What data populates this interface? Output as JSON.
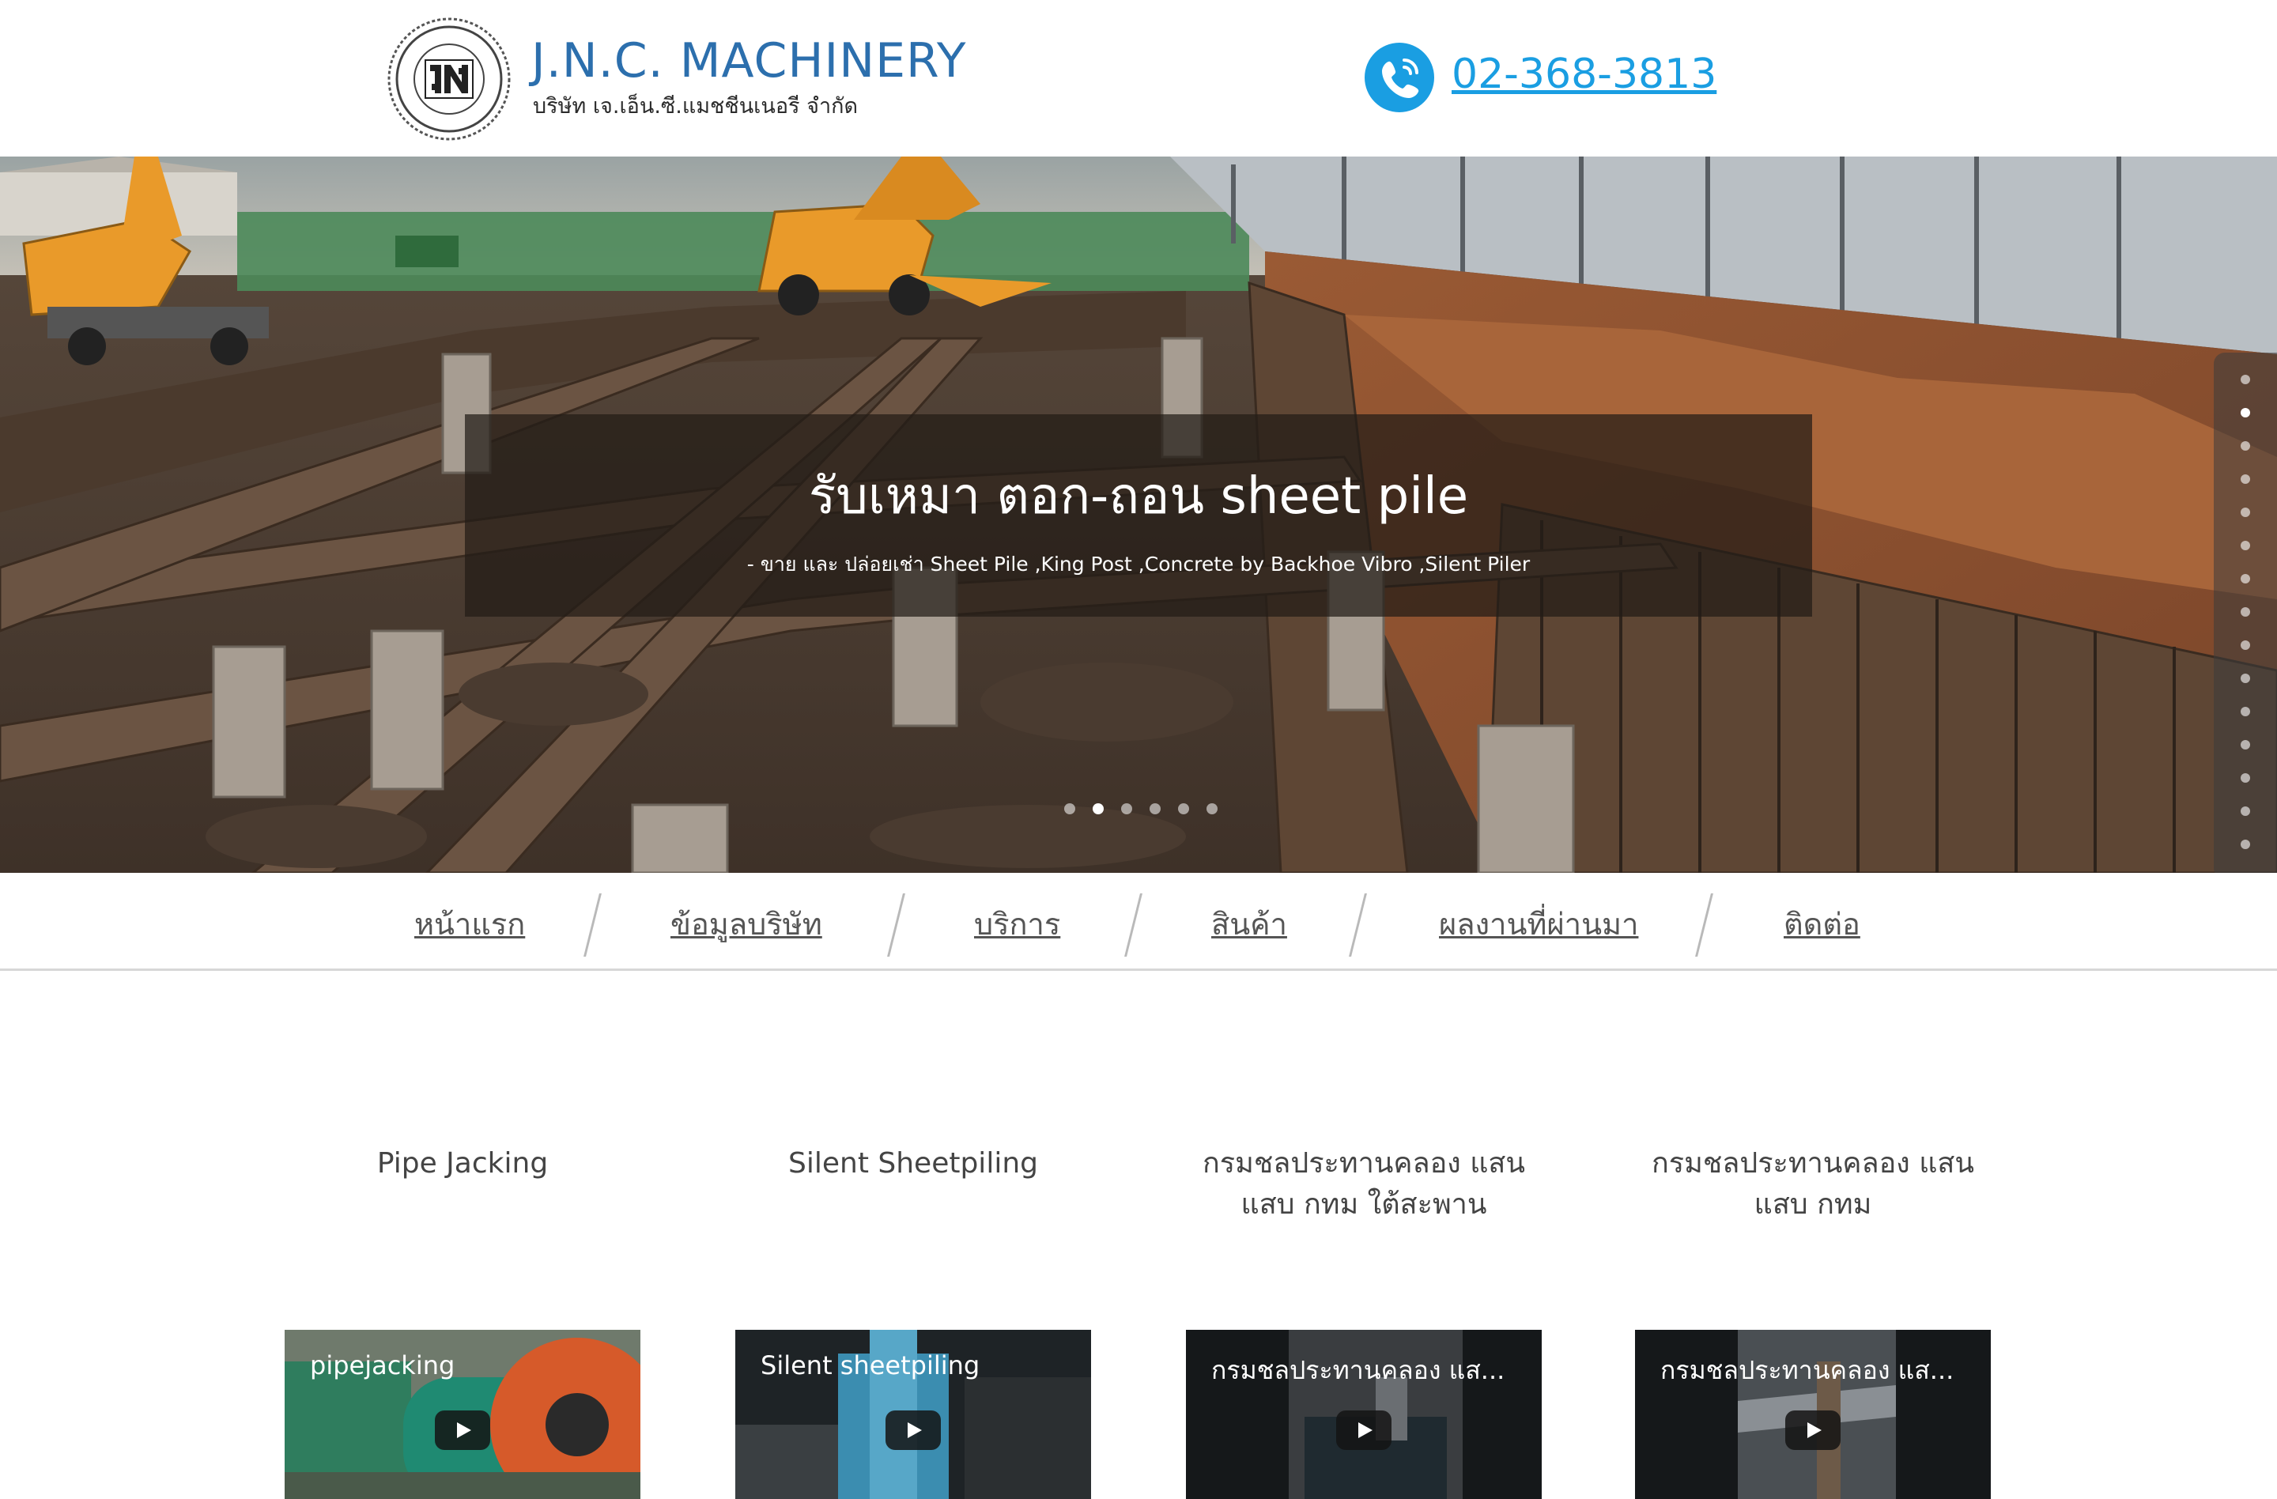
{
  "header": {
    "logo_icon": "jnc-machinery-seal-logo",
    "logo_text": "J.N.C. MACHINERY CO., LTD.",
    "brand_name": "J.N.C. MACHINERY",
    "brand_sub": "บริษัท เจ.เอ็น.ซี.แมชชีนเนอรี จำกัด",
    "phone_icon": "phone-icon",
    "phone_number": "02-368-3813"
  },
  "hero": {
    "caption_title": "รับเหมา ตอก-ถอน sheet pile",
    "caption_subtitle": "- ขาย และ ปล่อยเช่า Sheet Pile ,King Post ,Concrete by Backhoe Vibro ,Silent Piler",
    "slider_dot_count": 6,
    "slider_active_index": 1,
    "side_dot_count": 15,
    "side_active_index": 1
  },
  "nav": {
    "items": [
      {
        "label": "หน้าแรก"
      },
      {
        "label": "ข้อมูลบริษัท"
      },
      {
        "label": "บริการ"
      },
      {
        "label": "สินค้า"
      },
      {
        "label": "ผลงานที่ผ่านมา"
      },
      {
        "label": "ติดต่อ"
      }
    ]
  },
  "cards": [
    {
      "title": "Pipe Jacking",
      "video_title": "pipejacking"
    },
    {
      "title": "Silent Sheetpiling",
      "video_title": "Silent sheetpiling"
    },
    {
      "title": "กรมชลประทานคลอง แสนแสบ กทม ใต้สะพาน",
      "video_title": "กรมชลประทานคลอง แส..."
    },
    {
      "title": "กรมชลประทานคลอง แสนแสบ กทม",
      "video_title": "กรมชลประทานคลอง แส..."
    }
  ],
  "colors": {
    "brand_blue": "#2c6fad",
    "phone_blue": "#1a9ee2",
    "nav_text": "#555555"
  }
}
